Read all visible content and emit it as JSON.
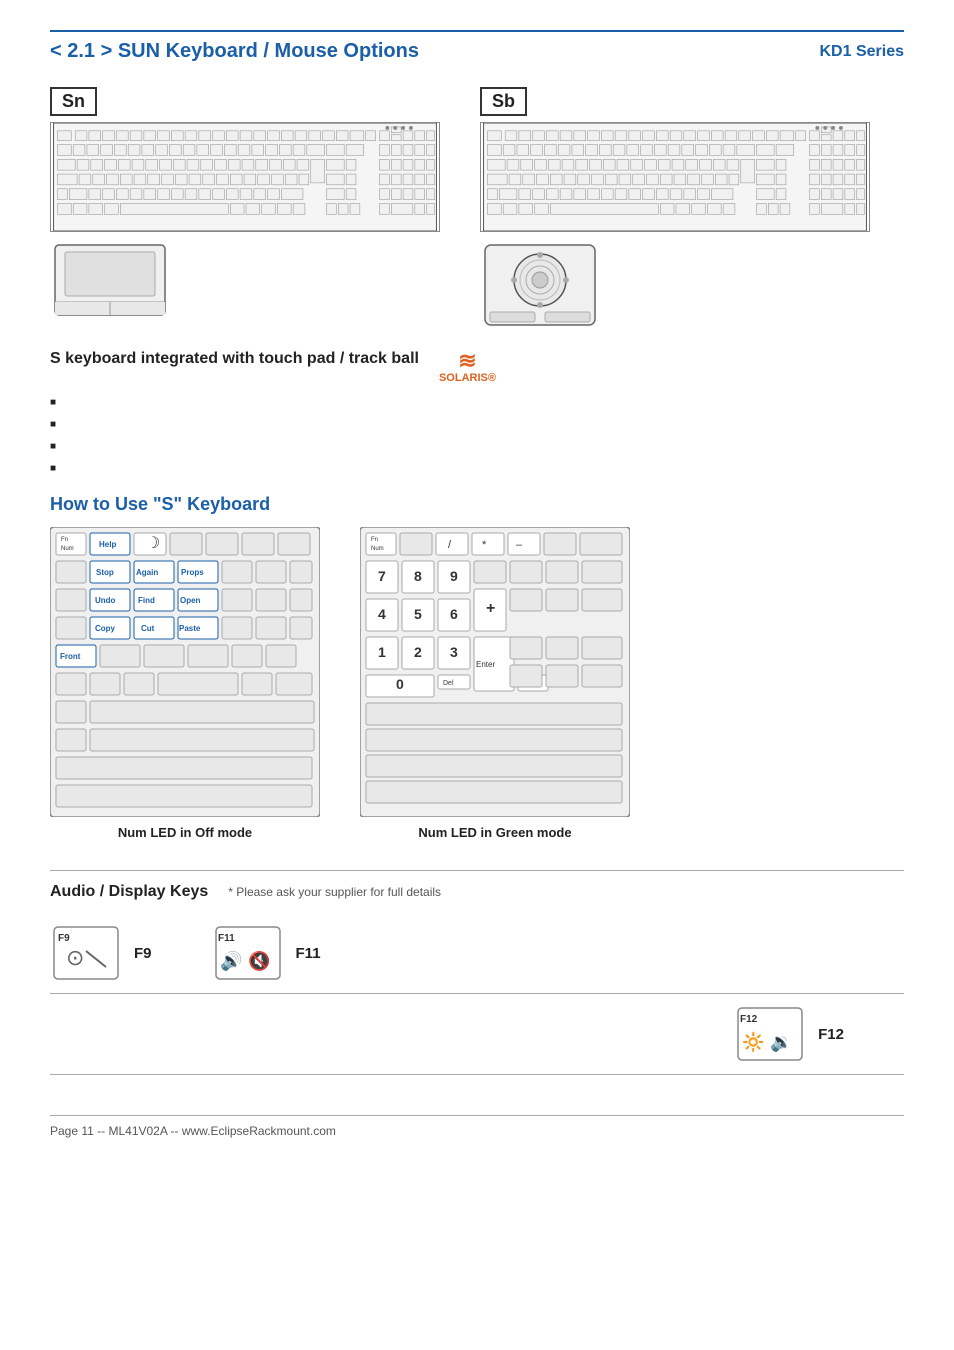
{
  "header": {
    "title": "< 2.1 > SUN Keyboard  /  Mouse Options",
    "series": "KD1 Series"
  },
  "keyboard_variants": [
    {
      "id": "Sn",
      "label": "Sn"
    },
    {
      "id": "Sb",
      "label": "Sb"
    }
  ],
  "description": {
    "text": "S keyboard integrated with touch pad  /  track ball",
    "solaris_label": "SOLARIS®",
    "bullets": [
      "",
      "",
      "",
      ""
    ]
  },
  "how_to_use": {
    "title": "How to Use \"S\" Keyboard",
    "diagram_left": {
      "label": "Num LED in Off mode",
      "keys_special": [
        "Help",
        "Stop",
        "Again",
        "Props",
        "Undo",
        "Find",
        "Open",
        "Copy",
        "Cut",
        "Paste",
        "Front"
      ],
      "keys_fn": "Fn\nNum"
    },
    "diagram_right": {
      "label": "Num LED in Green mode",
      "numpad": [
        "7",
        "8",
        "9",
        "4",
        "5",
        "6",
        "1",
        "2",
        "3",
        "0"
      ],
      "ops": [
        "/",
        "*",
        "–",
        "+",
        "Del",
        "Enter",
        "."
      ]
    }
  },
  "audio_section": {
    "title": "Audio / Display Keys",
    "note": "* Please ask your supplier for full details",
    "keys": [
      {
        "id": "F9",
        "label": "F9",
        "row": 0
      },
      {
        "id": "F11",
        "label": "F11",
        "row": 0
      },
      {
        "id": "F12",
        "label": "F12",
        "row": 1
      }
    ]
  },
  "footer": {
    "text": "Page 11 -- ML41V02A -- www.EclipseRackmount.com"
  }
}
